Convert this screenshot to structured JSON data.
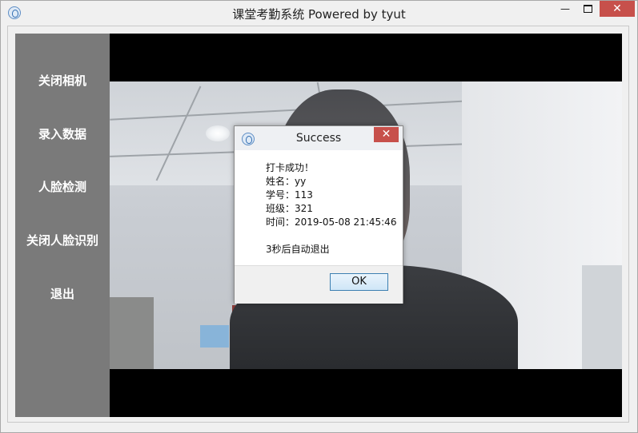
{
  "window": {
    "title": "课堂考勤系统 Powered by tyut",
    "minimize": "—",
    "close": "✕"
  },
  "sidebar": {
    "items": [
      {
        "label": "关闭相机"
      },
      {
        "label": "录入数据"
      },
      {
        "label": "人脸检测"
      },
      {
        "label": "关闭人脸识别"
      },
      {
        "label": "退出"
      }
    ]
  },
  "dialog": {
    "title": "Success",
    "close": "✕",
    "lines": [
      "打卡成功！",
      "姓名：yy",
      "学号：113",
      "班级：321",
      "时间：2019-05-08 21:45:46",
      "",
      "3秒后自动退出"
    ],
    "ok_label": "OK"
  },
  "colors": {
    "sidebar": "#7a7a7a",
    "close_button": "#c7504b",
    "ok_button_border": "#3c7fb1"
  }
}
